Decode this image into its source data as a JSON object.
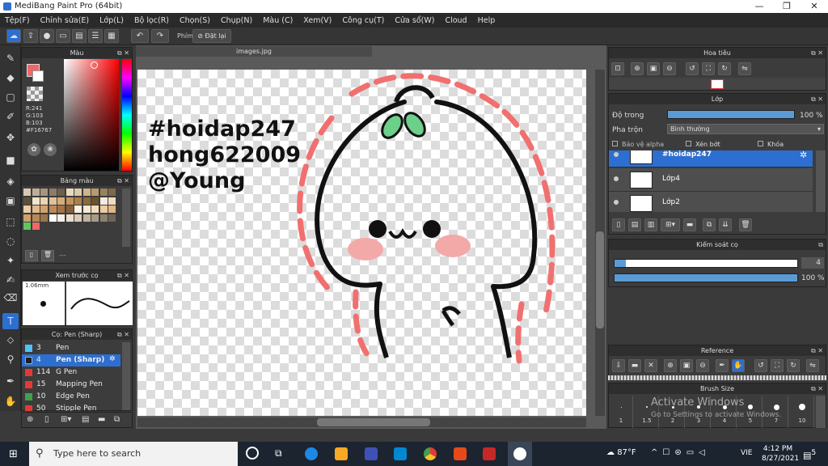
{
  "window": {
    "title": "MediBang Paint Pro (64bit)",
    "min": "—",
    "max": "❐",
    "close": "✕"
  },
  "menu": [
    "Tệp(F)",
    "Chỉnh sửa(E)",
    "Lớp(L)",
    "Bộ lọc(R)",
    "Chọn(S)",
    "Chụp(N)",
    "Màu (C)",
    "Xem(V)",
    "Công cụ(T)",
    "Cửa sổ(W)",
    "Cloud",
    "Help"
  ],
  "toolbar": {
    "shortcut_label": "Phím",
    "reset_label": "Đặt lại"
  },
  "color_panel": {
    "title": "Màu",
    "r": "R:241",
    "g": "G:103",
    "b": "B:103",
    "hex": "#F16767",
    "fg": "#F16767"
  },
  "palette_panel": {
    "title": "Bảng màu",
    "swatches": [
      "#d9c9b3",
      "#bfae97",
      "#a8957e",
      "#8f7c66",
      "#6e5e4c",
      "#e8d9c1",
      "#dcc8a8",
      "#cdb48d",
      "#b89a6f",
      "#98835f",
      "#7d6a4c",
      "#5f503a",
      "#f2e4cc",
      "#ebd4b0",
      "#e2c194",
      "#d6ac78",
      "#c4955e",
      "#ac8048",
      "#8c6939",
      "#6c512c",
      "#f5ebdc",
      "#f0dcc2",
      "#e9cca8",
      "#e0b98c",
      "#d2a170",
      "#bd8a58",
      "#a27349",
      "#86603c",
      "#fbf3e8",
      "#f7e8d3",
      "#f2dcbd",
      "#ebcca3",
      "#e0b788",
      "#cea06d",
      "#b78958",
      "#9b7447",
      "#ffffff",
      "#f6efe5",
      "#eadfd0",
      "#d9cbb8",
      "#c2b39f",
      "#a89a87",
      "#8c806f",
      "#6e6558",
      "#5dc75d",
      "#f16767"
    ],
    "footer": "---"
  },
  "brush_preview": {
    "title": "Xem trước cọ",
    "size": "1.06mm"
  },
  "brush_list": {
    "title": "Cọ: Pen (Sharp)",
    "items": [
      {
        "num": "3",
        "name": "Pen",
        "color": "#4fc3f7"
      },
      {
        "num": "4",
        "name": "Pen (Sharp)",
        "color": "#1e1e1e"
      },
      {
        "num": "114",
        "name": "G Pen",
        "color": "#e53935"
      },
      {
        "num": "15",
        "name": "Mapping Pen",
        "color": "#e53935"
      },
      {
        "num": "10",
        "name": "Edge Pen",
        "color": "#43a047"
      },
      {
        "num": "50",
        "name": "Stipple Pen",
        "color": "#e53935"
      }
    ]
  },
  "document": {
    "tab": "images.jpg",
    "line1": "#hoidap247",
    "line2": "hong622009",
    "line3": "@Young"
  },
  "navigator": {
    "title": "Hoa tiêu"
  },
  "layers": {
    "title": "Lớp",
    "opacity_label": "Độ trong",
    "opacity_value": "100 %",
    "blend_label": "Pha trộn",
    "blend_value": "Bình thường",
    "protect_alpha": "Bảo vệ alpha",
    "clipping": "Xén bớt",
    "lock": "Khóa",
    "items": [
      {
        "name": "#hoidap247"
      },
      {
        "name": "Lớp4"
      },
      {
        "name": "Lớp2"
      }
    ]
  },
  "brush_control": {
    "title": "Kiểm soát cọ",
    "size": "4",
    "opacity": "100 %"
  },
  "reference": {
    "title": "Reference"
  },
  "brush_size": {
    "title": "Brush Size",
    "values": [
      "1",
      "1.5",
      "2",
      "3",
      "4",
      "5",
      "7",
      "10"
    ],
    "watermark1": "Activate Windows",
    "watermark2": "Go to Settings to activate Windows."
  },
  "taskbar": {
    "search_placeholder": "Type here to search",
    "weather": "87°F",
    "lang": "VIE",
    "time": "4:12 PM",
    "date": "8/27/2021",
    "notif": "5"
  }
}
